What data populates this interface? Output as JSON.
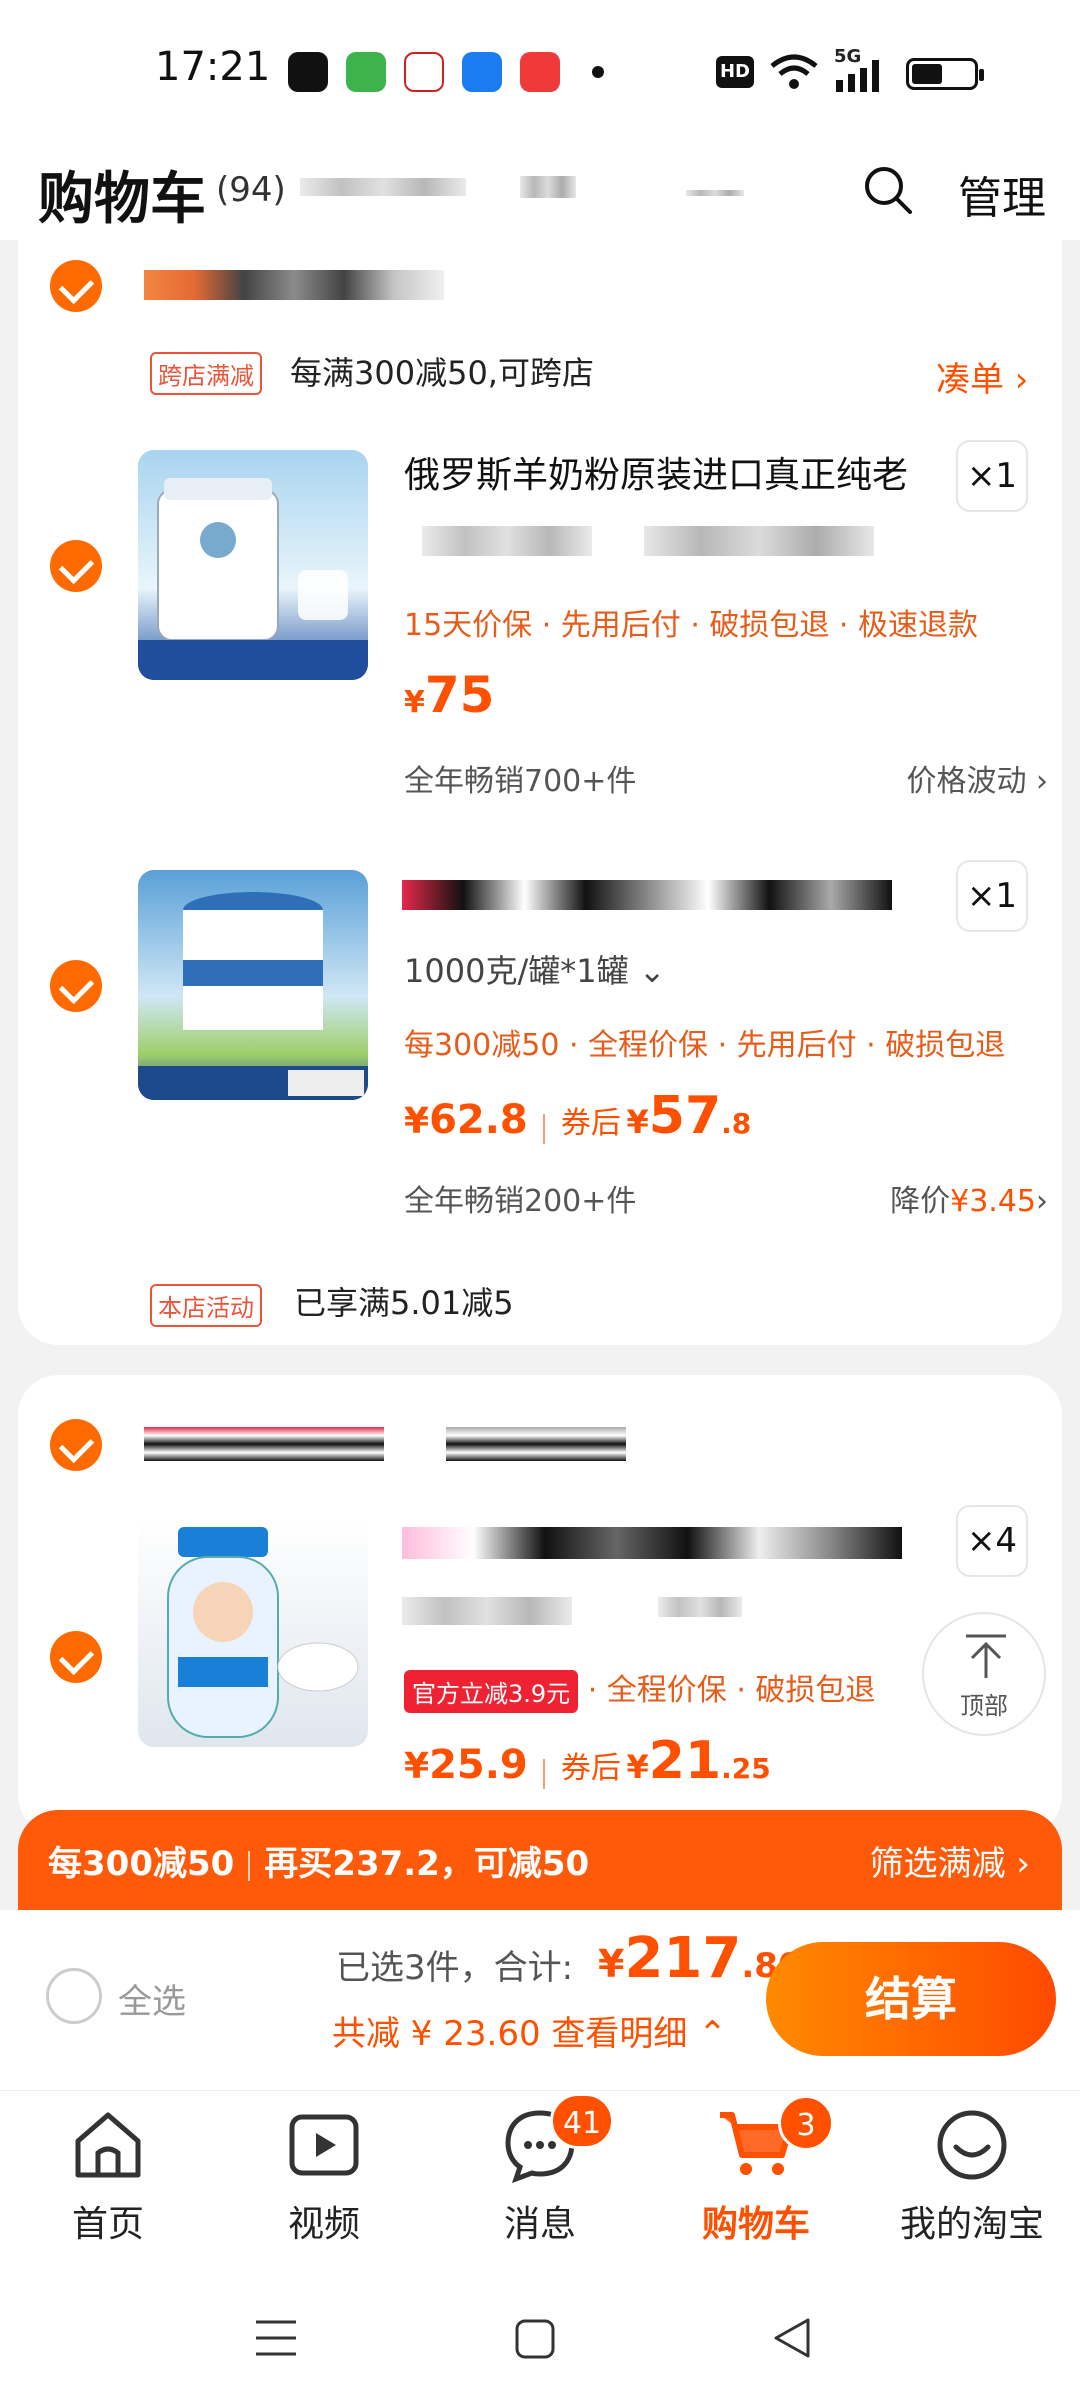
{
  "status_bar": {
    "time": "17:21",
    "network": "5G",
    "hd": "HD"
  },
  "header": {
    "title": "购物车",
    "count": "(94)",
    "manage": "管理"
  },
  "shop1": {
    "promo_tag": "跨店满减",
    "promo_text": "每满300减50,可跨店",
    "gather_label": "凑单 ›",
    "items": [
      {
        "title": "俄罗斯羊奶粉原装进口真正纯老",
        "variant": "",
        "benefits": "15天价保 · 先用后付 · 破损包退 · 极速退款",
        "price_currency": "¥",
        "price": "75",
        "qty": "×1",
        "sales": "全年畅销700+件",
        "right_link": "价格波动 ›"
      },
      {
        "title": "",
        "variant": "1000克/罐*1罐 ⌄",
        "benefits": "每300减50 · 全程价保 · 先用后付 · 破损包退",
        "price_currency": "¥",
        "price": "62.8",
        "coupon_label": "券后",
        "coupon_currency": "¥",
        "coupon_int": "57",
        "coupon_dec": ".8",
        "qty": "×1",
        "sales": "全年畅销200+件",
        "right_prefix": "降价",
        "right_value": "¥3.45",
        "right_arrow": "›"
      }
    ],
    "shop_promo_tag": "本店活动",
    "shop_promo_text": "已享满5.01减5"
  },
  "shop2": {
    "items": [
      {
        "official_tag": "官方立减3.9元",
        "benefits": " · 全程价保 · 破损包退",
        "price_currency": "¥",
        "price": "25.9",
        "coupon_label": "券后",
        "coupon_currency": "¥",
        "coupon_int": "21",
        "coupon_dec": ".25",
        "qty": "×4"
      }
    ]
  },
  "top_button": {
    "label": "顶部"
  },
  "discount_bar": {
    "left": "每300减50",
    "mid": "再买237.2，可减50",
    "right": "筛选满减 ›"
  },
  "checkout": {
    "select_all": "全选",
    "summary": "已选3件，合计:",
    "total_currency": "¥",
    "total_int": "217",
    "total_dec": ".80",
    "saved": "共减 ¥ 23.60  查看明细 ⌃",
    "button": "结算"
  },
  "tabbar": {
    "tabs": [
      {
        "label": "首页"
      },
      {
        "label": "视频"
      },
      {
        "label": "消息",
        "badge": "41"
      },
      {
        "label": "购物车",
        "badge": "3"
      },
      {
        "label": "我的淘宝"
      }
    ]
  },
  "colors": {
    "accent": "#ff5000",
    "check": "#ff6a00",
    "benefit": "#e65c1a"
  }
}
